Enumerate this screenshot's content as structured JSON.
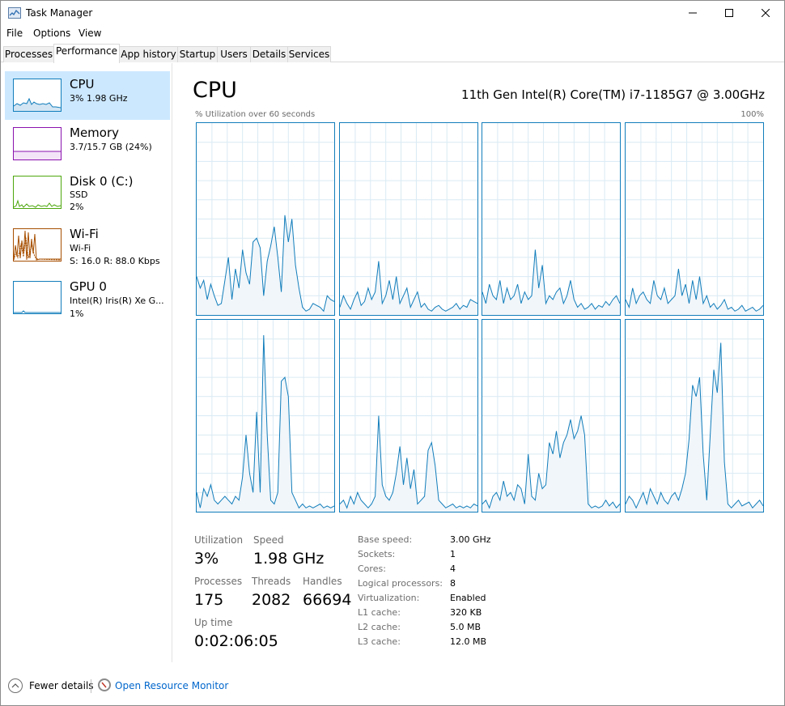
{
  "window": {
    "title": "Task Manager"
  },
  "menu": [
    "File",
    "Options",
    "View"
  ],
  "tabs": [
    "Processes",
    "Performance",
    "App history",
    "Startup",
    "Users",
    "Details",
    "Services"
  ],
  "active_tab": "Performance",
  "sidebar": [
    {
      "title": "CPU",
      "line1": "3%  1.98 GHz",
      "line2": "",
      "color": "#117dbb"
    },
    {
      "title": "Memory",
      "line1": "3.7/15.7 GB (24%)",
      "line2": "",
      "color": "#8b12ae"
    },
    {
      "title": "Disk 0 (C:)",
      "line1": "SSD",
      "line2": "2%",
      "color": "#4da60c"
    },
    {
      "title": "Wi-Fi",
      "line1": "Wi-Fi",
      "line2": "S: 16.0  R: 88.0 Kbps",
      "color": "#a74f01"
    },
    {
      "title": "GPU 0",
      "line1": "Intel(R) Iris(R) Xe G...",
      "line2": "1%",
      "color": "#117dbb"
    }
  ],
  "main": {
    "heading": "CPU",
    "model": "11th Gen Intel(R) Core(TM) i7-1185G7 @ 3.00GHz",
    "util_caption": "% Utilization over 60 seconds",
    "util_max": "100%"
  },
  "stats": {
    "utilization_label": "Utilization",
    "utilization_value": "3%",
    "speed_label": "Speed",
    "speed_value": "1.98 GHz",
    "processes_label": "Processes",
    "processes_value": "175",
    "threads_label": "Threads",
    "threads_value": "2082",
    "handles_label": "Handles",
    "handles_value": "66694",
    "uptime_label": "Up time",
    "uptime_value": "0:02:06:05"
  },
  "specs": [
    {
      "label": "Base speed:",
      "value": "3.00 GHz"
    },
    {
      "label": "Sockets:",
      "value": "1"
    },
    {
      "label": "Cores:",
      "value": "4"
    },
    {
      "label": "Logical processors:",
      "value": "8"
    },
    {
      "label": "Virtualization:",
      "value": "Enabled"
    },
    {
      "label": "L1 cache:",
      "value": "320 KB"
    },
    {
      "label": "L2 cache:",
      "value": "5.0 MB"
    },
    {
      "label": "L3 cache:",
      "value": "12.0 MB"
    }
  ],
  "footer": {
    "fewer_details": "Fewer details",
    "open_resource_monitor": "Open Resource Monitor"
  },
  "colors": {
    "accent": "#117dbb",
    "grid": "#d9eaf4",
    "fill": "#f1f6fa",
    "link": "#0066cc",
    "selected": "#cce8ff"
  },
  "cpu_graphs": [
    [
      20,
      14,
      18,
      8,
      16,
      10,
      5,
      6,
      18,
      30,
      8,
      24,
      14,
      34,
      22,
      16,
      38,
      40,
      35,
      10,
      28,
      36,
      46,
      30,
      12,
      52,
      38,
      50,
      26,
      14,
      4,
      2,
      3,
      6,
      5,
      4,
      2,
      10,
      8,
      7
    ],
    [
      4,
      10,
      6,
      3,
      8,
      12,
      5,
      7,
      14,
      8,
      12,
      28,
      6,
      10,
      18,
      8,
      20,
      6,
      10,
      14,
      4,
      8,
      12,
      4,
      6,
      3,
      2,
      4,
      5,
      3,
      2,
      3,
      4,
      6,
      3,
      5,
      4,
      8,
      7,
      6
    ],
    [
      12,
      6,
      16,
      10,
      8,
      18,
      6,
      14,
      8,
      10,
      16,
      6,
      12,
      8,
      10,
      34,
      14,
      26,
      6,
      10,
      8,
      12,
      14,
      6,
      10,
      18,
      8,
      4,
      6,
      3,
      4,
      6,
      3,
      5,
      4,
      7,
      5,
      8,
      10,
      6
    ],
    [
      8,
      4,
      14,
      6,
      10,
      12,
      8,
      6,
      18,
      10,
      8,
      14,
      6,
      8,
      10,
      24,
      10,
      16,
      6,
      18,
      8,
      20,
      6,
      10,
      4,
      6,
      3,
      5,
      8,
      3,
      4,
      2,
      3,
      5,
      2,
      3,
      4,
      2,
      3,
      5
    ],
    [
      10,
      2,
      12,
      8,
      14,
      6,
      4,
      6,
      8,
      6,
      4,
      8,
      6,
      18,
      40,
      20,
      10,
      52,
      10,
      92,
      40,
      6,
      4,
      10,
      68,
      70,
      60,
      10,
      6,
      2,
      4,
      2,
      3,
      2,
      3,
      4,
      2,
      3,
      2,
      3
    ],
    [
      4,
      6,
      2,
      8,
      4,
      10,
      6,
      4,
      2,
      4,
      8,
      50,
      14,
      8,
      6,
      10,
      20,
      34,
      14,
      28,
      12,
      22,
      4,
      6,
      8,
      32,
      36,
      24,
      6,
      4,
      2,
      3,
      4,
      2,
      3,
      2,
      3,
      2,
      4,
      3
    ],
    [
      4,
      6,
      2,
      8,
      10,
      6,
      16,
      8,
      10,
      6,
      14,
      12,
      4,
      30,
      8,
      6,
      20,
      12,
      14,
      36,
      30,
      42,
      28,
      36,
      40,
      48,
      38,
      42,
      50,
      40,
      4,
      2,
      3,
      2,
      3,
      6,
      3,
      5,
      2,
      4
    ],
    [
      4,
      8,
      6,
      2,
      6,
      10,
      4,
      12,
      8,
      4,
      10,
      6,
      4,
      8,
      10,
      6,
      12,
      20,
      38,
      66,
      60,
      70,
      30,
      6,
      40,
      74,
      62,
      88,
      26,
      4,
      2,
      4,
      6,
      3,
      4,
      5,
      2,
      4,
      6,
      3
    ]
  ]
}
